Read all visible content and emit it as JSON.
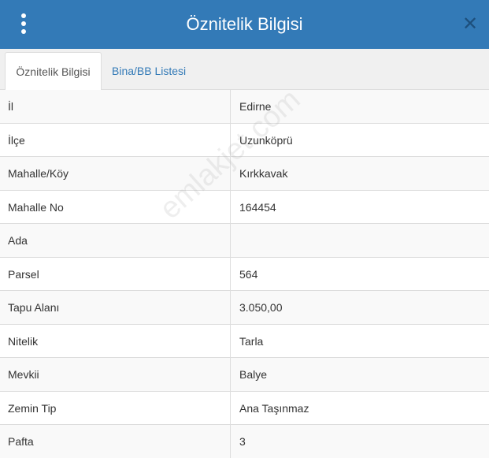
{
  "header": {
    "title": "Öznitelik Bilgisi",
    "menu_icon": "vertical-dots-icon",
    "close_icon": "close-icon"
  },
  "tabs": [
    {
      "label": "Öznitelik Bilgisi",
      "active": true
    },
    {
      "label": "Bina/BB Listesi",
      "active": false
    }
  ],
  "rows": [
    {
      "key": "İl",
      "value": "Edirne"
    },
    {
      "key": "İlçe",
      "value": "Uzunköprü"
    },
    {
      "key": "Mahalle/Köy",
      "value": "Kırkkavak"
    },
    {
      "key": "Mahalle No",
      "value": "164454"
    },
    {
      "key": "Ada",
      "value": ""
    },
    {
      "key": "Parsel",
      "value": "564"
    },
    {
      "key": "Tapu Alanı",
      "value": "3.050,00"
    },
    {
      "key": "Nitelik",
      "value": "Tarla"
    },
    {
      "key": "Mevkii",
      "value": "Balye"
    },
    {
      "key": "Zemin Tip",
      "value": "Ana Taşınmaz"
    },
    {
      "key": "Pafta",
      "value": "3"
    }
  ],
  "watermark": "emlakjet.com",
  "colors": {
    "header_bg": "#337ab7",
    "link": "#337ab7",
    "close": "#1d4f7c"
  }
}
